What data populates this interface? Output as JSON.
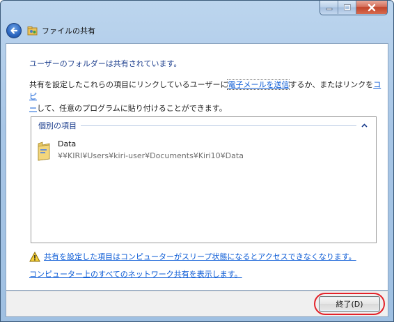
{
  "window": {
    "title": "ファイルの共有",
    "caption_buttons": [
      "minimize",
      "maximize",
      "close"
    ]
  },
  "main": {
    "heading": "ユーザーのフォルダーは共有されています。",
    "para_part1": "共有を設定したこれらの項目にリンクしているユーザーに",
    "email_link": "電子メールを送信",
    "para_part2": "するか、またはリンクを",
    "copy_link_1": "コピ",
    "copy_link_2": "ー",
    "para_part3": "して、任意のプログラムに貼り付けることができます。"
  },
  "list": {
    "group_label": "個別の項目",
    "items": [
      {
        "name": "Data",
        "path": "¥¥KIRI¥Users¥kiri-user¥Documents¥Kiri10¥Data",
        "icon": "folder-icon"
      }
    ]
  },
  "warning_link": "共有を設定した項目はコンピューターがスリープ状態になるとアクセスできなくなります。",
  "network_link": "コンピューター上のすべてのネットワーク共有を表示します。",
  "footer": {
    "finish_label": "終了(D)"
  },
  "colors": {
    "link": "#0b5bd6",
    "heading": "#1a3c8c",
    "highlight": "#e3222a"
  }
}
